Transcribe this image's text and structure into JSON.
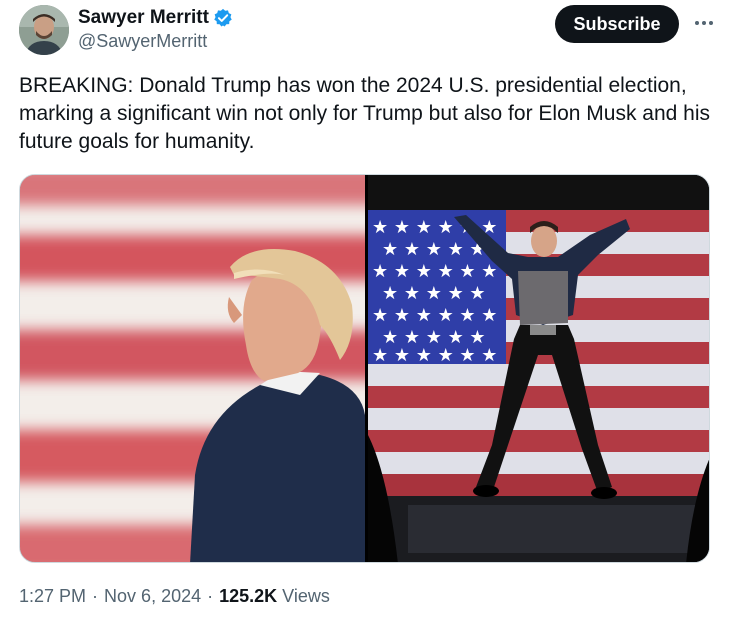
{
  "author": {
    "display_name": "Sawyer Merritt",
    "handle": "@SawyerMerritt",
    "verified_icon": "verified-badge-icon"
  },
  "header": {
    "subscribe_label": "Subscribe",
    "more_icon": "more-horizontal-icon"
  },
  "tweet": {
    "text": "BREAKING: Donald Trump has won the 2024 U.S. presidential election, marking a significant win not only for Trump but also for Elon Musk and his future goals for humanity."
  },
  "media": [
    {
      "name": "photo-trump-flag"
    },
    {
      "name": "photo-musk-stage"
    }
  ],
  "meta": {
    "time": "1:27 PM",
    "separator": "·",
    "date": "Nov 6, 2024",
    "views_count": "125.2K",
    "views_label": "Views"
  },
  "colors": {
    "accent": "#1d9bf0",
    "text_primary": "#0f1419",
    "text_secondary": "#536471",
    "button_bg": "#0f1419"
  }
}
